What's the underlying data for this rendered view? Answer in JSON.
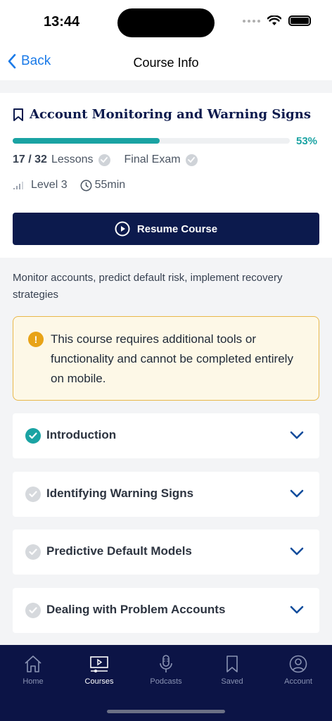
{
  "status_bar": {
    "time": "13:44"
  },
  "nav": {
    "back_label": "Back",
    "title": "Course Info"
  },
  "course": {
    "title": "Account Monitoring and Warning Signs",
    "progress_percent": 53,
    "progress_label": "53%",
    "lessons_count": "17 / 32",
    "lessons_label": "Lessons",
    "final_exam_label": "Final Exam",
    "level_label": "Level 3",
    "duration_label": "55min",
    "resume_label": "Resume Course"
  },
  "description": "Monitor accounts, predict default risk, implement recovery strategies",
  "warning": {
    "text": "This course requires additional tools or functionality and cannot be completed entirely on mobile."
  },
  "sections": [
    {
      "label": "Introduction",
      "completed": true
    },
    {
      "label": "Identifying Warning Signs",
      "completed": false
    },
    {
      "label": "Predictive Default Models",
      "completed": false
    },
    {
      "label": "Dealing with Problem Accounts",
      "completed": false
    }
  ],
  "tabs": [
    {
      "label": "Home",
      "icon": "home-icon",
      "active": false
    },
    {
      "label": "Courses",
      "icon": "courses-icon",
      "active": true
    },
    {
      "label": "Podcasts",
      "icon": "microphone-icon",
      "active": false
    },
    {
      "label": "Saved",
      "icon": "bookmark-icon",
      "active": false
    },
    {
      "label": "Account",
      "icon": "account-icon",
      "active": false
    }
  ],
  "colors": {
    "accent_teal": "#1aa3a3",
    "navy": "#0c1a4d",
    "tab_bar": "#0c1446",
    "link_blue": "#1a7ae8",
    "warning_border": "#e8b84a"
  }
}
